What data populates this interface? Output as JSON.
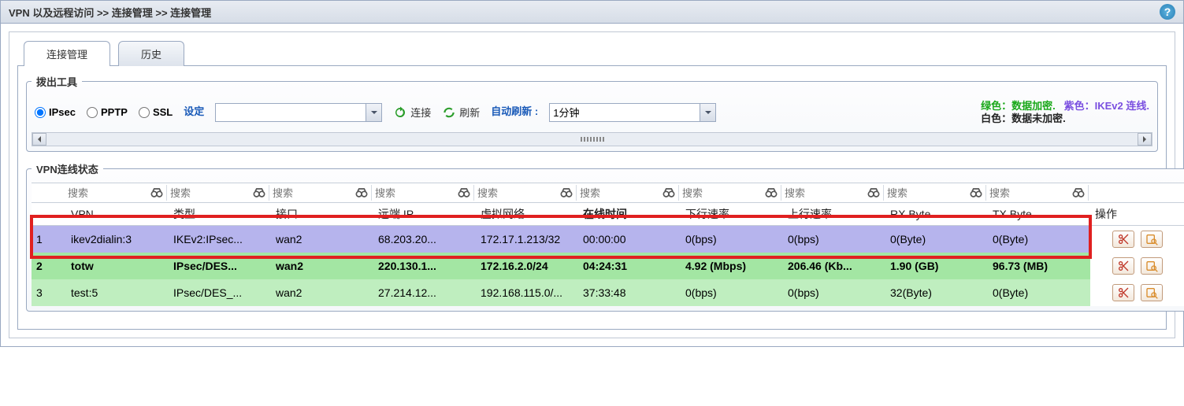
{
  "breadcrumb": "VPN 以及远程访问 >> 连接管理 >> 连接管理",
  "tabs": {
    "active": "连接管理",
    "inactive": "历史"
  },
  "dialout": {
    "legend": "拨出工具",
    "radios": {
      "ipsec": "IPsec",
      "pptp": "PPTP",
      "ssl": "SSL"
    },
    "profile_label": "设定",
    "profile_value": "",
    "connect": "连接",
    "refresh": "刷新",
    "auto_refresh_label": "自动刷新",
    "auto_refresh_value": "1分钟",
    "legend_green": "绿色：数据加密.",
    "legend_purple": "紫色：IKEv2 连线.",
    "legend_white": "白色：数据未加密."
  },
  "status": {
    "legend": "VPN连线状态",
    "search_placeholder": "搜索",
    "columns": {
      "vpn": "VPN",
      "type": "类型",
      "iface": "接口",
      "remote_ip": "远端 IP",
      "vnet": "虚拟网络",
      "uptime": "在线时间",
      "down": "下行速率",
      "up": "上行速率",
      "rx": "RX Byte",
      "tx": "TX Byte",
      "ops": "操作"
    },
    "rows": [
      {
        "idx": "1",
        "vpn": "ikev2dialin:3",
        "type": "IKEv2:IPsec...",
        "iface": "wan2",
        "remote_ip": "68.203.20...",
        "vnet": "172.17.1.213/32",
        "uptime": "00:00:00",
        "down": "0(bps)",
        "up": "0(bps)",
        "rx": "0(Byte)",
        "tx": "0(Byte)"
      },
      {
        "idx": "2",
        "vpn": "totw",
        "type": "IPsec/DES...",
        "iface": "wan2",
        "remote_ip": "220.130.1...",
        "vnet": "172.16.2.0/24",
        "uptime": "04:24:31",
        "down": "4.92 (Mbps)",
        "up": "206.46 (Kb...",
        "rx": "1.90 (GB)",
        "tx": "96.73 (MB)"
      },
      {
        "idx": "3",
        "vpn": "test:5",
        "type": "IPsec/DES_...",
        "iface": "wan2",
        "remote_ip": "27.214.12...",
        "vnet": "192.168.115.0/...",
        "uptime": "37:33:48",
        "down": "0(bps)",
        "up": "0(bps)",
        "rx": "32(Byte)",
        "tx": "0(Byte)"
      }
    ]
  }
}
